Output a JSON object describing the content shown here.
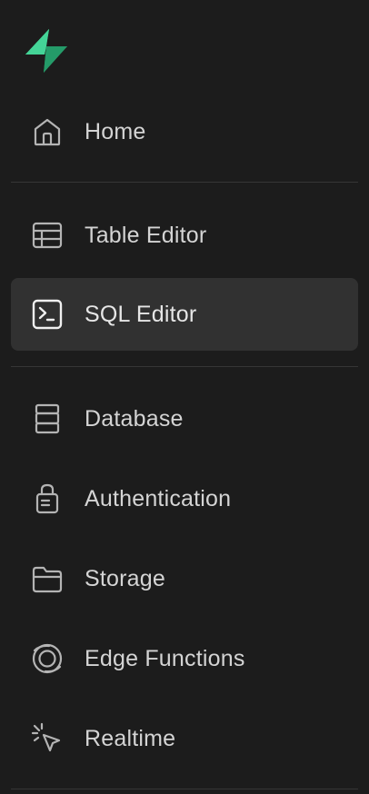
{
  "sidebar": {
    "logo": {
      "icon": "supabase-bolt-logo-icon",
      "color": "#3ecf8e"
    },
    "items": [
      {
        "label": "Home",
        "icon": "home-icon",
        "active": false
      },
      {
        "label": "Table Editor",
        "icon": "table-icon",
        "active": false
      },
      {
        "label": "SQL Editor",
        "icon": "terminal-icon",
        "active": true
      },
      {
        "label": "Database",
        "icon": "database-icon",
        "active": false
      },
      {
        "label": "Authentication",
        "icon": "lock-icon",
        "active": false
      },
      {
        "label": "Storage",
        "icon": "folder-icon",
        "active": false
      },
      {
        "label": "Edge Functions",
        "icon": "globe-icon",
        "active": false
      },
      {
        "label": "Realtime",
        "icon": "cursor-click-icon",
        "active": false
      }
    ]
  },
  "colors": {
    "background": "#1c1c1c",
    "active_background": "#313131",
    "divider": "#363636",
    "text": "#d4d4d4",
    "icon": "#b4b4b4",
    "brand": "#3ecf8e"
  }
}
